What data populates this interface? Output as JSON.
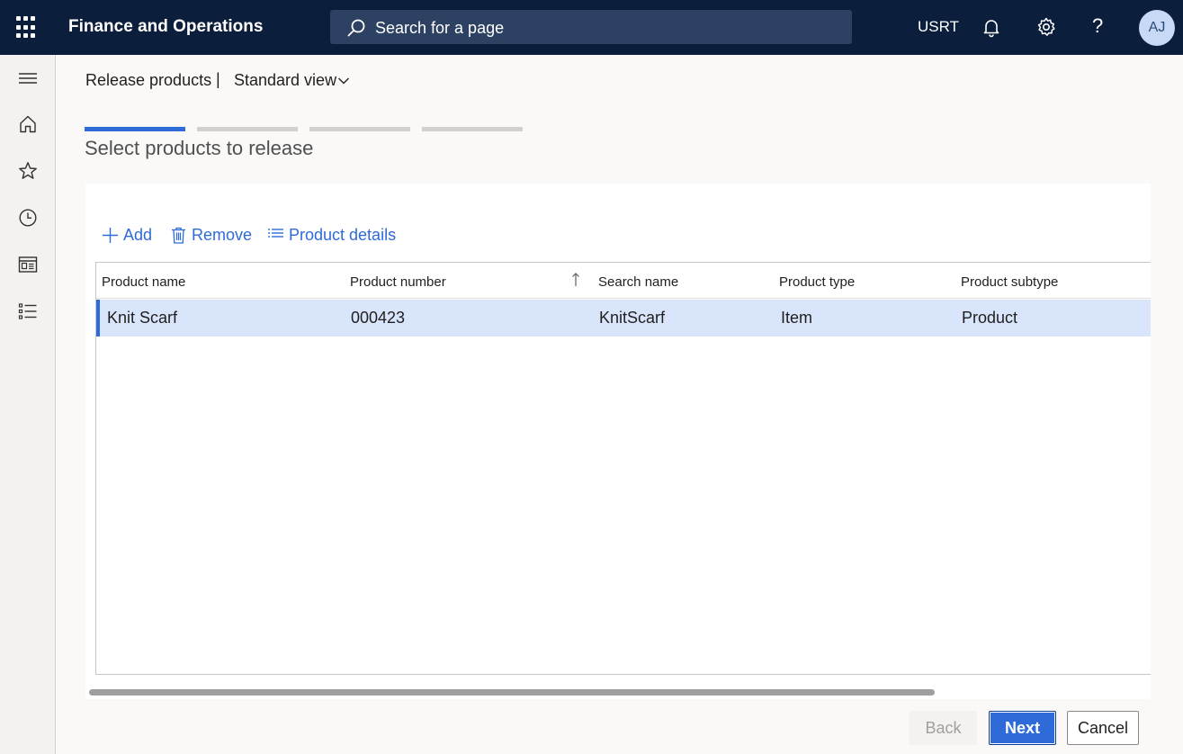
{
  "topbar": {
    "app_title": "Finance and Operations",
    "search_placeholder": "Search for a page",
    "company": "USRT",
    "user_initials": "AJ",
    "help_glyph": "?"
  },
  "nav_icons": [
    "menu-icon",
    "home-icon",
    "star-icon",
    "clock-icon",
    "workspace-icon",
    "list-icon"
  ],
  "header": {
    "breadcrumb": "Release products",
    "separator": "|",
    "view": "Standard view"
  },
  "wizard": {
    "steps_total": 4,
    "current_step": 1,
    "title": "Select products to release"
  },
  "actions": {
    "add": "Add",
    "remove": "Remove",
    "product_details": "Product details"
  },
  "grid": {
    "columns": [
      "Product name",
      "Product number",
      "Search name",
      "Product type",
      "Product subtype"
    ],
    "sorted_column": "Product number",
    "rows": [
      {
        "product_name": "Knit Scarf",
        "product_number": "000423",
        "search_name": "KnitScarf",
        "product_type": "Item",
        "product_subtype": "Product"
      }
    ]
  },
  "footer": {
    "back": "Back",
    "next": "Next",
    "cancel": "Cancel"
  },
  "colors": {
    "topbar": "#0b1e3c",
    "accent": "#2e6bd8",
    "selected_row": "#d9e5fb"
  }
}
